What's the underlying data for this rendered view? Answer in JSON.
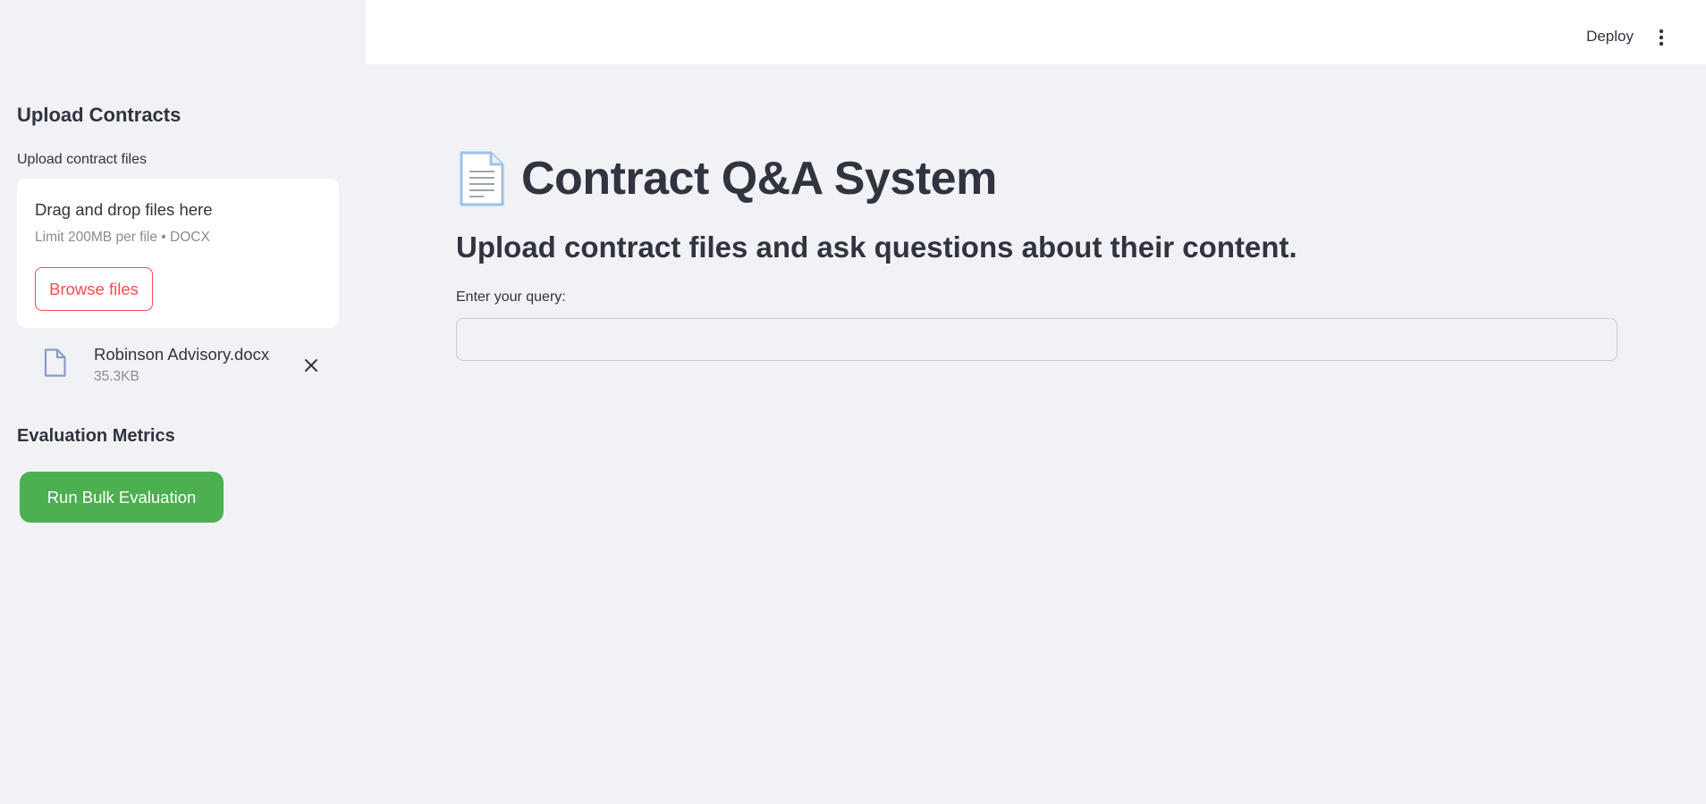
{
  "header": {
    "deploy_label": "Deploy",
    "menu_icon": "kebab-menu-icon"
  },
  "sidebar": {
    "title": "Upload Contracts",
    "uploader_label": "Upload contract files",
    "dropzone": {
      "title": "Drag and drop files here",
      "limit_text": "Limit 200MB per file • DOCX",
      "browse_label": "Browse files"
    },
    "uploaded_file": {
      "name": "Robinson Advisory.docx",
      "size": "35.3KB",
      "icon": "file-icon",
      "remove_icon": "close-icon"
    },
    "eval_title": "Evaluation Metrics",
    "run_button_label": "Run Bulk Evaluation",
    "run_button_color": "#4caf50"
  },
  "main": {
    "title_icon": "page-facing-up-icon",
    "title": "Contract Q&A System",
    "subtitle": "Upload contract files and ask questions about their content.",
    "query_label": "Enter your query:",
    "query_value": "",
    "query_placeholder": ""
  },
  "colors": {
    "accent": "#ff4b4b",
    "background": "#f0f2f6",
    "text": "#31333f"
  }
}
